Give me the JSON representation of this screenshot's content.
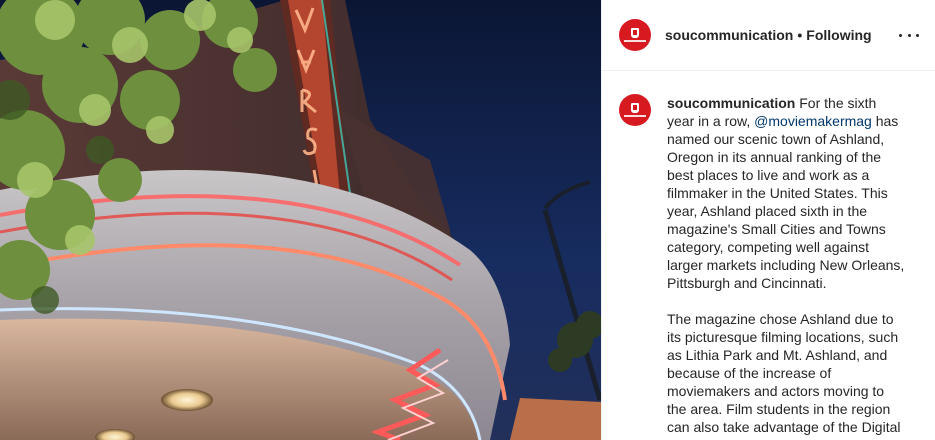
{
  "post": {
    "username": "soucommunication",
    "follow_status": "Following",
    "separator": "•",
    "caption": {
      "username": "soucommunication",
      "lead": "For the sixth year in a row,",
      "mention": "@moviemakermag",
      "p1_rest": "has named our scenic town of Ashland, Oregon in its annual ranking of the best places to live and work as a filmmaker in the United States. This year, Ashland placed sixth in the magazine's Small Cities and Towns category, competing well against larger markets including New Orleans, Pittsburgh and Cincinnati.",
      "p2": "The magazine chose Ashland due to its picturesque filming locations, such as Lithia Park and Mt. Ashland, and because of the increase of moviemakers and actors moving to the area. Film students in the region can also take advantage of the Digital"
    },
    "photo": {
      "sign_text": "VARSITY",
      "description_icon": "theater-marquee-photo"
    }
  },
  "icons": {
    "avatar": "university-logo-icon",
    "more": "more-options-icon"
  },
  "colors": {
    "brand_red": "#d71920",
    "text": "#262626",
    "mention": "#00376b",
    "divider": "#efefef"
  }
}
